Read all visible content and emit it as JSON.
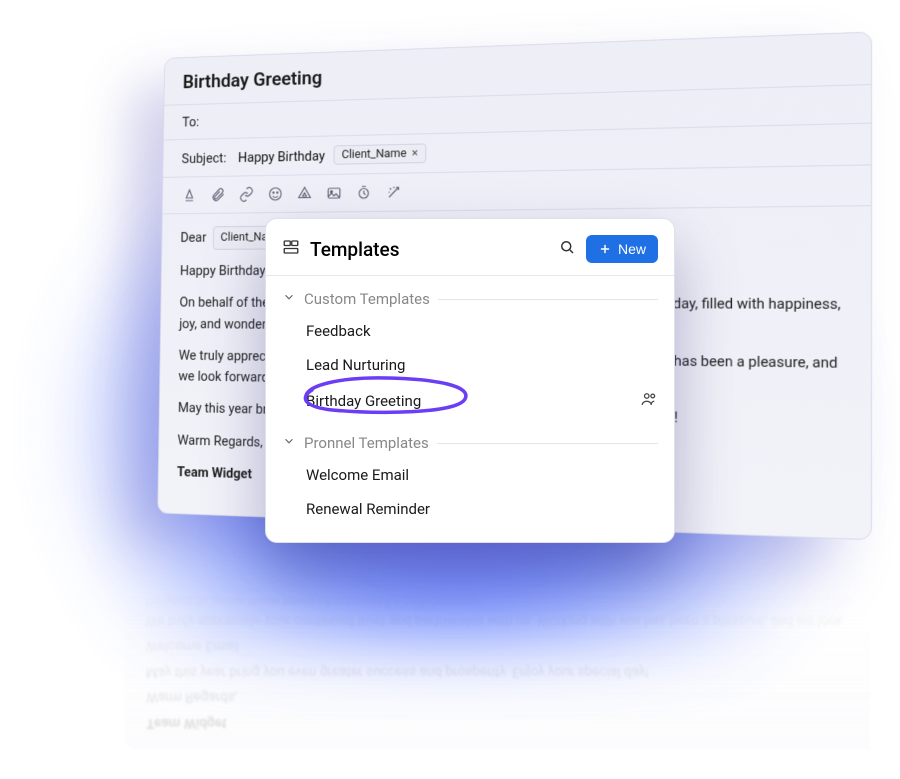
{
  "composer": {
    "title": "Birthday Greeting",
    "to_label": "To:",
    "subject_label": "Subject:",
    "subject_text": "Happy Birthday",
    "chip_var": "Client_Name",
    "chip_x": "×",
    "body": {
      "dear": "Dear",
      "chip_var": "Client_Name",
      "chip_x": "×",
      "p1": "Happy Birthday!",
      "p2": "On behalf of the entire team at Widget, we would like to wish you a very happy birthday, filled with happiness, joy, and wonderful memories.",
      "p3": "We truly appreciate your continued trust and partnership with us. Working with you has been a pleasure, and we look forward to many more years of successful collaboration.",
      "p4": "May this year bring you even greater success and prosperity. Enjoy your special day!",
      "sign1": "Warm Regards,",
      "sign2": "Team Widget"
    }
  },
  "popover": {
    "title": "Templates",
    "new_label": "New",
    "sections": [
      {
        "title": "Custom Templates",
        "items": [
          "Feedback",
          "Lead Nurturing",
          "Birthday Greeting"
        ]
      },
      {
        "title": "Pronnel Templates",
        "items": [
          "Welcome Email",
          "Renewal Reminder"
        ]
      }
    ]
  }
}
